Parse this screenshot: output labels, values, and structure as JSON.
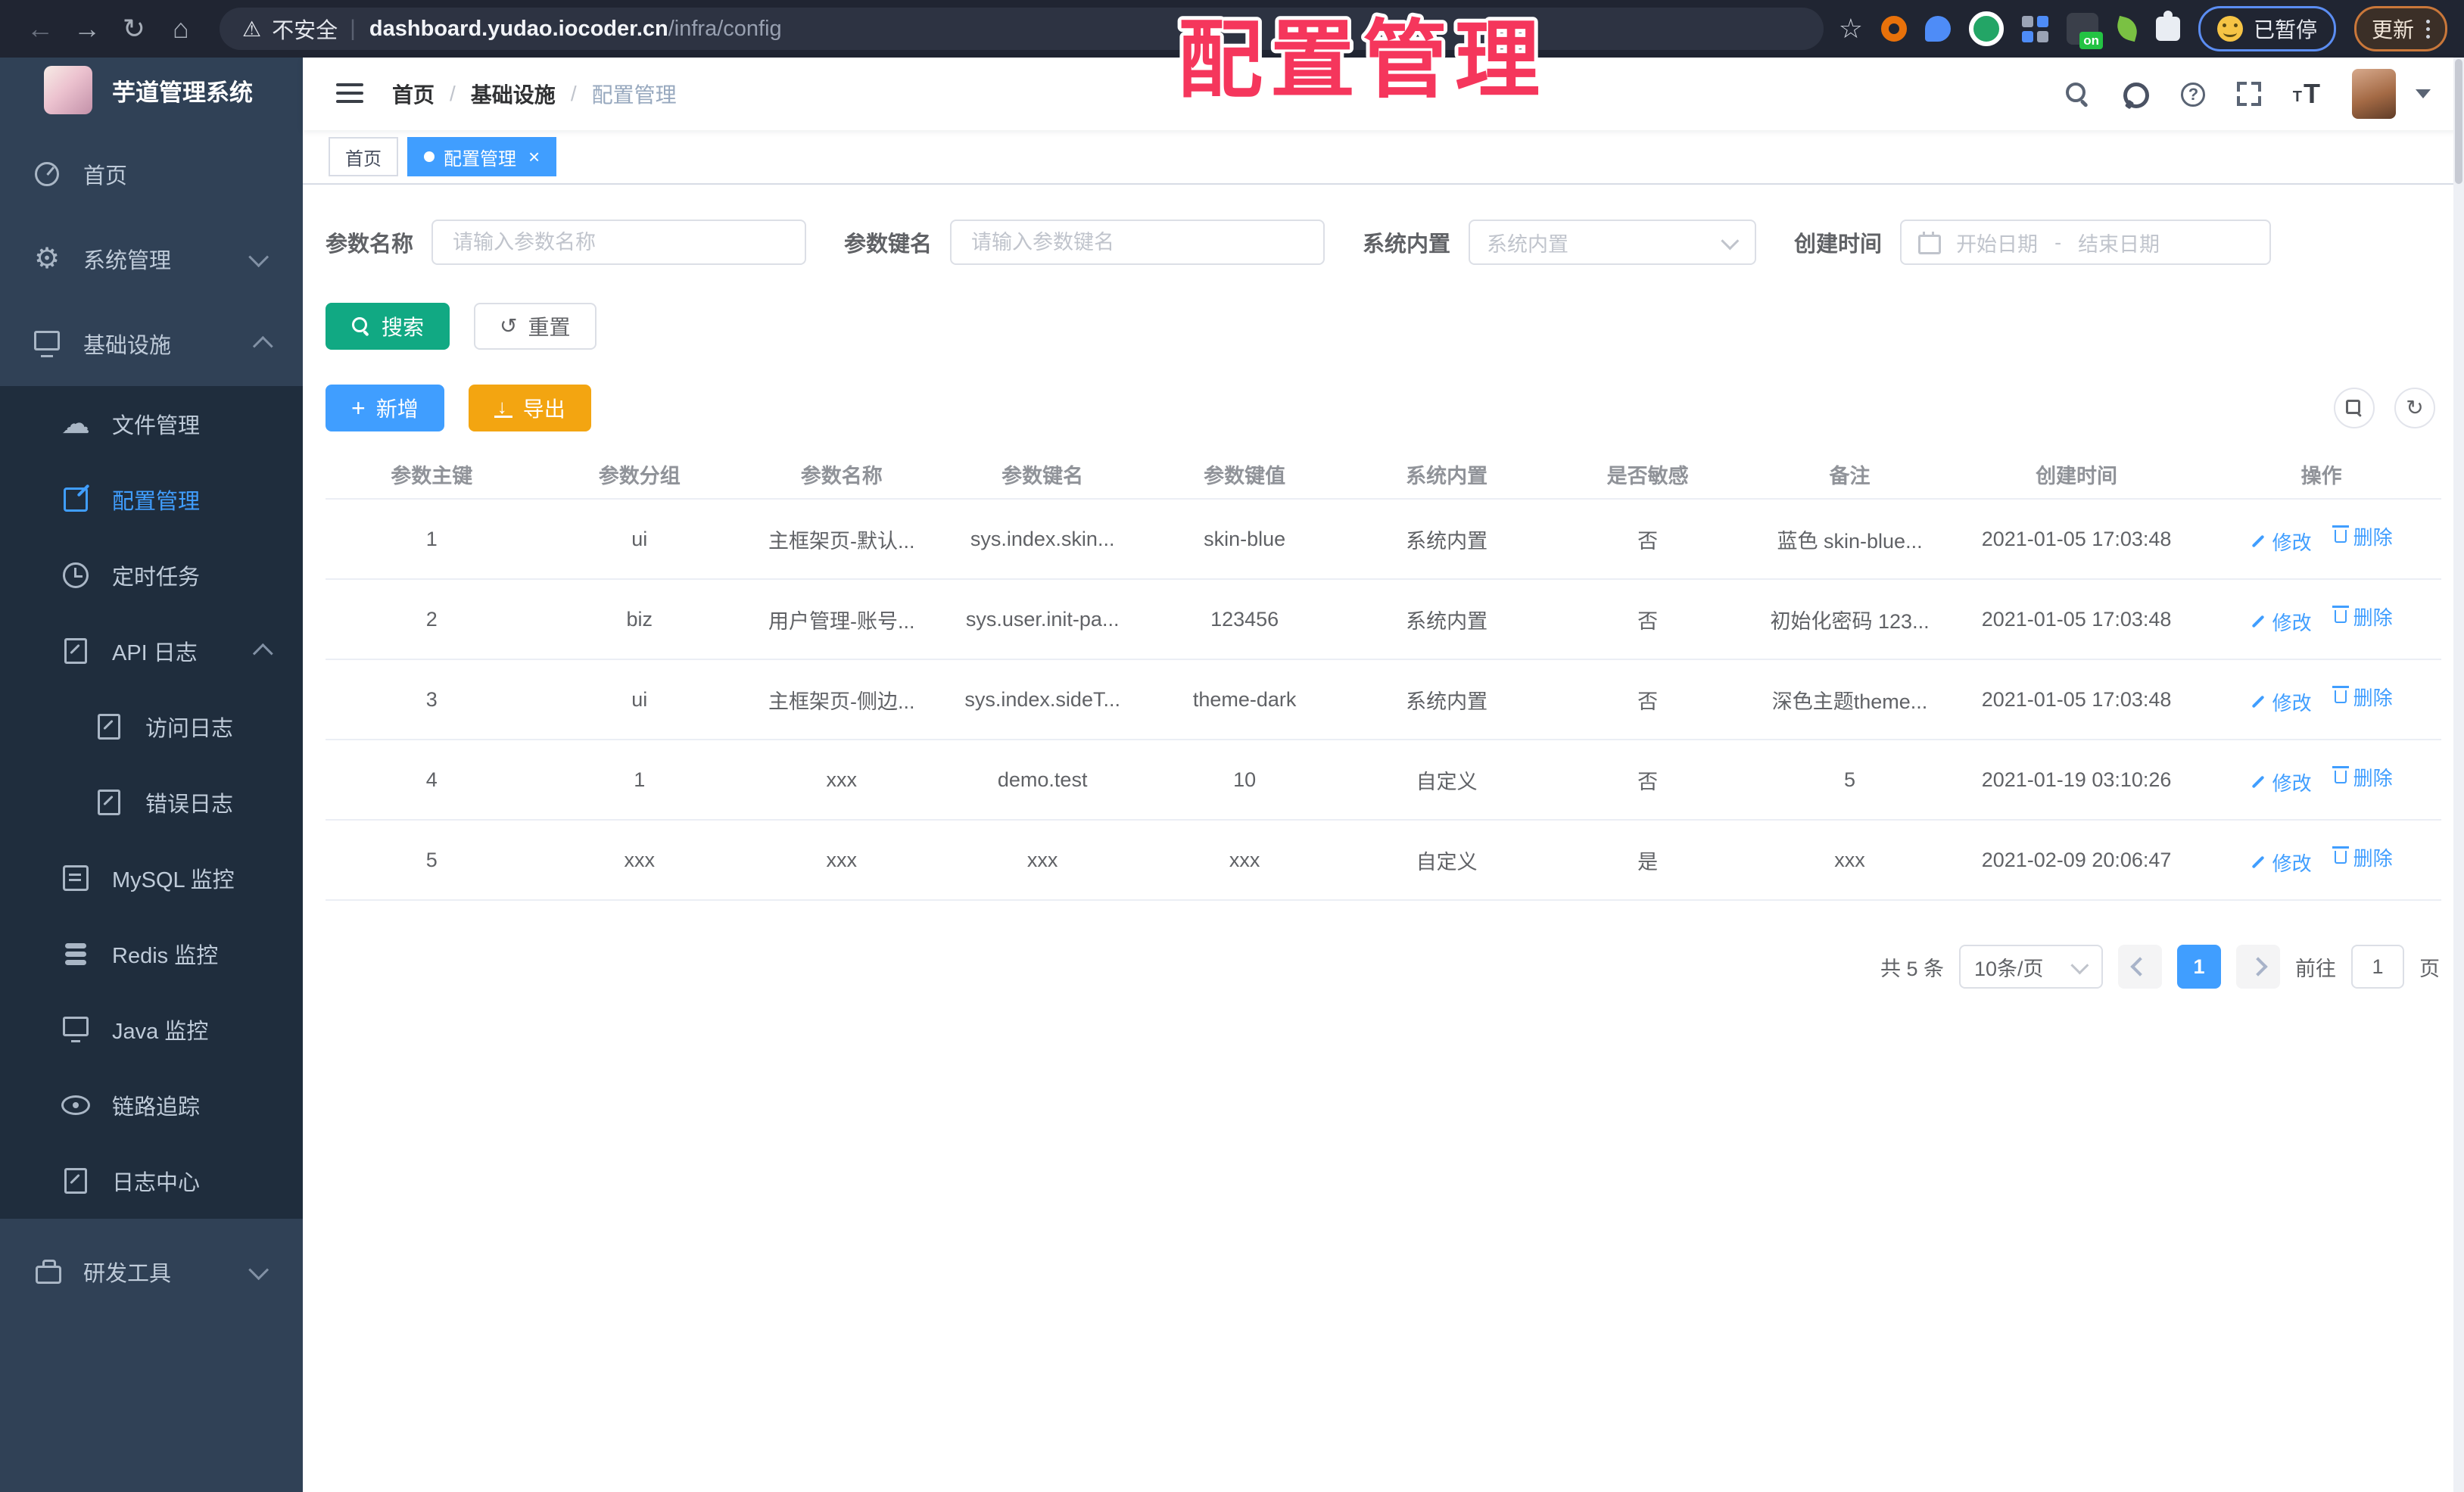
{
  "overlay_title": "配置管理",
  "browser": {
    "security_label": "不安全",
    "url_host": "dashboard.yudao.iocoder.cn",
    "url_path": "/infra/config",
    "extension_badge_on": "on",
    "paused_badge": "已暂停",
    "update_label": "更新"
  },
  "sidebar": {
    "logo_title": "芋道管理系统",
    "items": [
      {
        "id": "home",
        "label": "首页",
        "icon": "dashboard"
      },
      {
        "id": "system",
        "label": "系统管理",
        "icon": "gear",
        "chevron": "down"
      },
      {
        "id": "infra",
        "label": "基础设施",
        "icon": "infra",
        "chevron": "up",
        "children": [
          {
            "id": "file",
            "label": "文件管理",
            "icon": "cloud"
          },
          {
            "id": "config",
            "label": "配置管理",
            "icon": "edit",
            "active": true
          },
          {
            "id": "job",
            "label": "定时任务",
            "icon": "clock"
          },
          {
            "id": "api-log",
            "label": "API 日志",
            "icon": "log",
            "chevron": "up",
            "children": [
              {
                "id": "access-log",
                "label": "访问日志",
                "icon": "log"
              },
              {
                "id": "error-log",
                "label": "错误日志",
                "icon": "log"
              }
            ]
          },
          {
            "id": "mysql",
            "label": "MySQL 监控",
            "icon": "mysql"
          },
          {
            "id": "redis",
            "label": "Redis 监控",
            "icon": "redis"
          },
          {
            "id": "java",
            "label": "Java 监控",
            "icon": "java"
          },
          {
            "id": "tracer",
            "label": "链路追踪",
            "icon": "eye"
          },
          {
            "id": "log-center",
            "label": "日志中心",
            "icon": "log"
          }
        ]
      },
      {
        "id": "dev-tools",
        "label": "研发工具",
        "icon": "briefcase",
        "chevron": "down"
      }
    ]
  },
  "header": {
    "breadcrumb": [
      "首页",
      "基础设施",
      "配置管理"
    ],
    "separator": "/"
  },
  "tabs": [
    {
      "label": "首页",
      "active": false
    },
    {
      "label": "配置管理",
      "active": true
    }
  ],
  "filters": {
    "name_label": "参数名称",
    "name_placeholder": "请输入参数名称",
    "key_label": "参数键名",
    "key_placeholder": "请输入参数键名",
    "type_label": "系统内置",
    "type_placeholder": "系统内置",
    "date_label": "创建时间",
    "date_start_placeholder": "开始日期",
    "date_separator": "-",
    "date_end_placeholder": "结束日期"
  },
  "toolbar": {
    "search_label": "搜索",
    "reset_label": "重置",
    "add_label": "新增",
    "export_label": "导出"
  },
  "table": {
    "headers": [
      "参数主键",
      "参数分组",
      "参数名称",
      "参数键名",
      "参数键值",
      "系统内置",
      "是否敏感",
      "备注",
      "创建时间",
      "操作"
    ],
    "rows": [
      [
        "1",
        "ui",
        "主框架页-默认...",
        "sys.index.skin...",
        "skin-blue",
        "系统内置",
        "否",
        "蓝色 skin-blue...",
        "2021-01-05 17:03:48"
      ],
      [
        "2",
        "biz",
        "用户管理-账号...",
        "sys.user.init-pa...",
        "123456",
        "系统内置",
        "否",
        "初始化密码 123...",
        "2021-01-05 17:03:48"
      ],
      [
        "3",
        "ui",
        "主框架页-侧边...",
        "sys.index.sideT...",
        "theme-dark",
        "系统内置",
        "否",
        "深色主题theme...",
        "2021-01-05 17:03:48"
      ],
      [
        "4",
        "1",
        "xxx",
        "demo.test",
        "10",
        "自定义",
        "否",
        "5",
        "2021-01-19 03:10:26"
      ],
      [
        "5",
        "xxx",
        "xxx",
        "xxx",
        "xxx",
        "自定义",
        "是",
        "xxx",
        "2021-02-09 20:06:47"
      ]
    ],
    "op_edit": "修改",
    "op_delete": "删除"
  },
  "pagination": {
    "total": "共 5 条",
    "page_size": "10条/页",
    "current_page": "1",
    "goto_label": "前往",
    "goto_value": "1",
    "page_unit": "页"
  },
  "colors": {
    "accent_blue": "#409eff",
    "search_teal": "#11a983",
    "export_amber": "#f3a511",
    "overlay_red": "#f5365c",
    "sidebar_bg": "#304156",
    "submenu_bg": "#1f2d3d",
    "browser_bg": "#202532"
  }
}
